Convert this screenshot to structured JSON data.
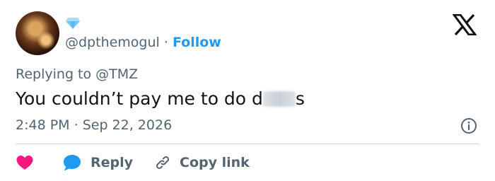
{
  "user": {
    "handle": "@dpthemogul",
    "separator": "·",
    "follow_label": "Follow",
    "verified_icon": "diamond-badge-icon",
    "avatar_icon": "avatar-photo"
  },
  "tweet": {
    "replying_prefix": "Replying to",
    "replying_to": "@TMZ",
    "text_before": "You couldn’t pay me to do d",
    "text_after": "s",
    "time": "2:48 PM",
    "separator": "·",
    "date": "Sep 22, 2026"
  },
  "actions": {
    "reply_label": "Reply",
    "copy_label": "Copy link"
  },
  "colors": {
    "accent": "#1d9bf0",
    "heart": "#f91880",
    "muted": "#536471",
    "text": "#0f1419"
  }
}
